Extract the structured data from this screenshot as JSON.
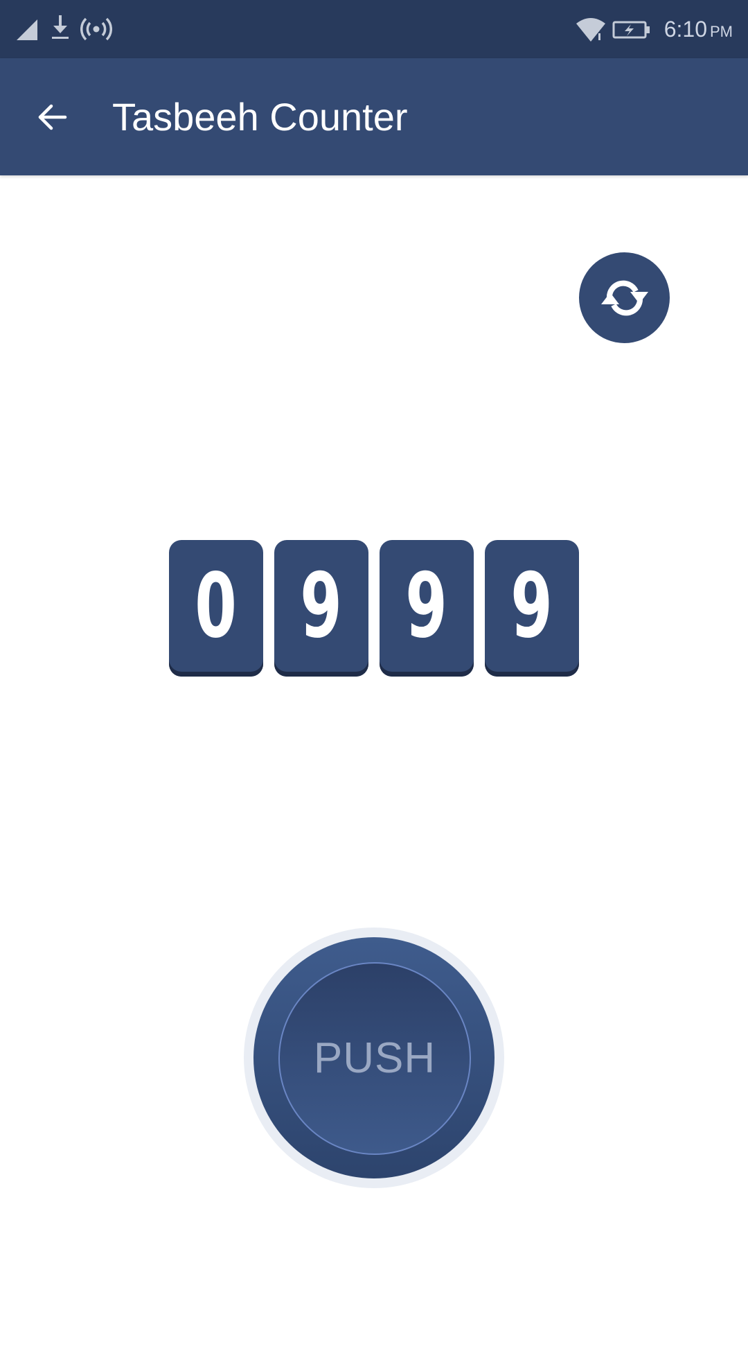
{
  "status_bar": {
    "time": "6:10",
    "am_pm": "PM",
    "icons": [
      "signal-icon",
      "download-icon",
      "hotspot-icon",
      "wifi-icon",
      "battery-charging-icon"
    ]
  },
  "app_bar": {
    "title": "Tasbeeh Counter",
    "back_icon": "arrow-left-icon"
  },
  "reset_button": {
    "icon": "refresh-icon"
  },
  "counter": {
    "digits": [
      "0",
      "9",
      "9",
      "9"
    ]
  },
  "push_button": {
    "label": "PUSH"
  },
  "colors": {
    "status_bar": "#283a5c",
    "app_bar": "#344a73",
    "accent": "#344a73",
    "push_label": "#9aa8c3",
    "background": "#ffffff"
  }
}
